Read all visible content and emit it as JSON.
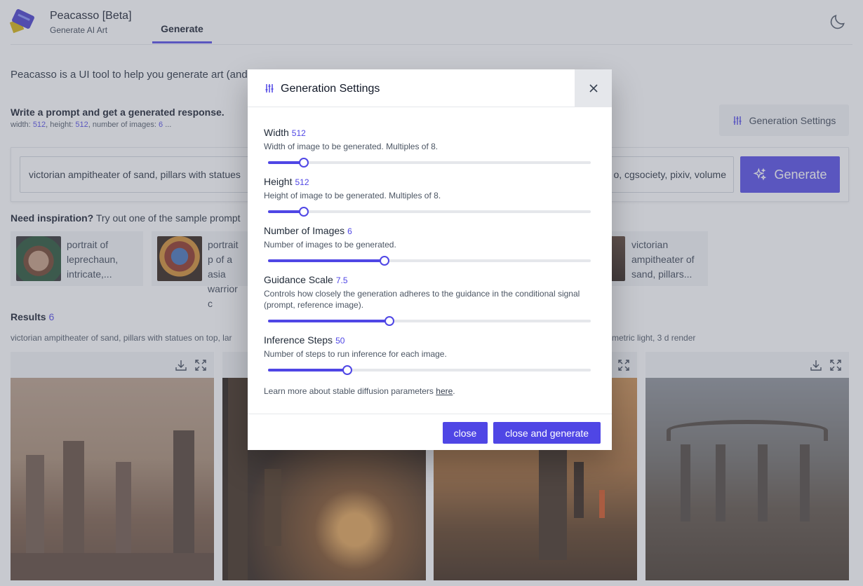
{
  "app": {
    "title": "Peacasso [Beta]",
    "subtitle": "Generate AI Art",
    "nav_tab": "Generate",
    "theme_icon": "moon-icon"
  },
  "intro_text": "Peacasso is a UI tool to help you generate art (and ex",
  "prompt_section": {
    "heading": "Write a prompt and get a generated response.",
    "settings_summary": {
      "width_label": "width:",
      "width": "512",
      "height_label": ", height:",
      "height": "512",
      "images_label": ", number of images:",
      "images": "6",
      "ellipsis": " ..."
    },
    "settings_button": "Generation Settings",
    "prompt_value": "victorian ampitheater of sand, pillars with statues",
    "prompt_value_tail": "o, cgsociety, pixiv, volume",
    "generate_button": "Generate"
  },
  "inspiration": {
    "lead": "Need inspiration?",
    "text": " Try out one of the sample prompt",
    "samples": [
      {
        "text": "portrait of leprechaun, intricate,..."
      },
      {
        "text": "portrait p of a asia warrior c"
      },
      {
        "text": "victorian ampitheater of sand, pillars..."
      }
    ]
  },
  "results": {
    "heading": "Results",
    "count": "6",
    "prompt_left": "victorian ampitheater of sand, pillars with statues on top, lar",
    "prompt_right": "metric light, 3 d render",
    "download_icon": "download-icon",
    "expand_icon": "expand-icon"
  },
  "modal": {
    "title": "Generation Settings",
    "params": [
      {
        "label": "Width",
        "value": "512",
        "desc": "Width of image to be generated. Multiples of 8.",
        "fraction": 0.11
      },
      {
        "label": "Height",
        "value": "512",
        "desc": "Height of image to be generated. Multiples of 8.",
        "fraction": 0.11
      },
      {
        "label": "Number of Images",
        "value": "6",
        "desc": "Number of images to be generated.",
        "fraction": 0.36
      },
      {
        "label": "Guidance Scale",
        "value": "7.5",
        "desc": "Controls how closely the generation adheres to the guidance in the conditional signal (prompt, reference image).",
        "fraction": 0.375
      },
      {
        "label": "Inference Steps",
        "value": "50",
        "desc": "Number of steps to run inference for each image.",
        "fraction": 0.245
      }
    ],
    "learn_more": "Learn more about stable diffusion parameters ",
    "learn_link": "here",
    "learn_end": ".",
    "close_button": "close",
    "close_generate_button": "close and generate"
  },
  "colors": {
    "accent": "#4f46e5",
    "overlay": "#6b7280"
  }
}
